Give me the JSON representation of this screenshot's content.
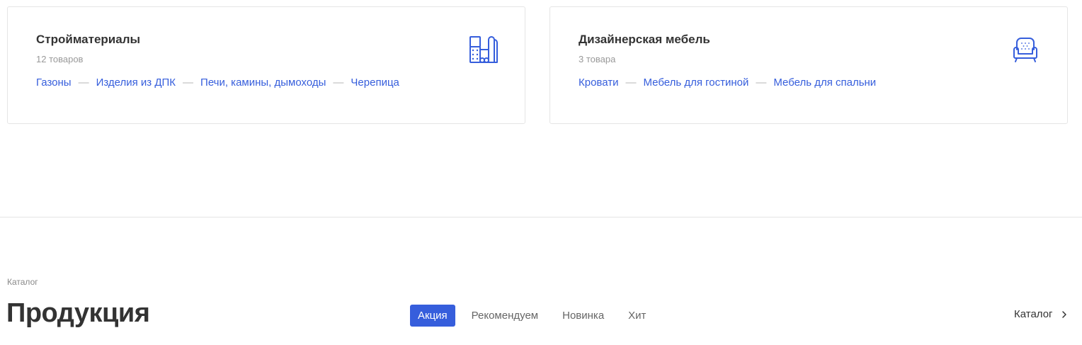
{
  "cards": [
    {
      "title": "Стройматериалы",
      "count": "12 товаров",
      "icon": "building-materials-icon",
      "links": [
        "Газоны",
        "Изделия из ДПК",
        "Печи, камины, дымоходы",
        "Черепица"
      ]
    },
    {
      "title": "Дизайнерская мебель",
      "count": "3 товара",
      "icon": "armchair-icon",
      "links": [
        "Кровати",
        "Мебель для гостиной",
        "Мебель для спальни"
      ]
    }
  ],
  "separator": "—",
  "section": {
    "breadcrumb": "Каталог",
    "title": "Продукция",
    "tabs": [
      {
        "label": "Акция",
        "active": true
      },
      {
        "label": "Рекомендуем",
        "active": false
      },
      {
        "label": "Новинка",
        "active": false
      },
      {
        "label": "Хит",
        "active": false
      }
    ],
    "catalog_link": "Каталог",
    "catalog_icon": "chevron-right-icon"
  },
  "colors": {
    "accent": "#365edc",
    "text": "#333333",
    "muted": "#999999",
    "border": "#e5e5e5"
  }
}
